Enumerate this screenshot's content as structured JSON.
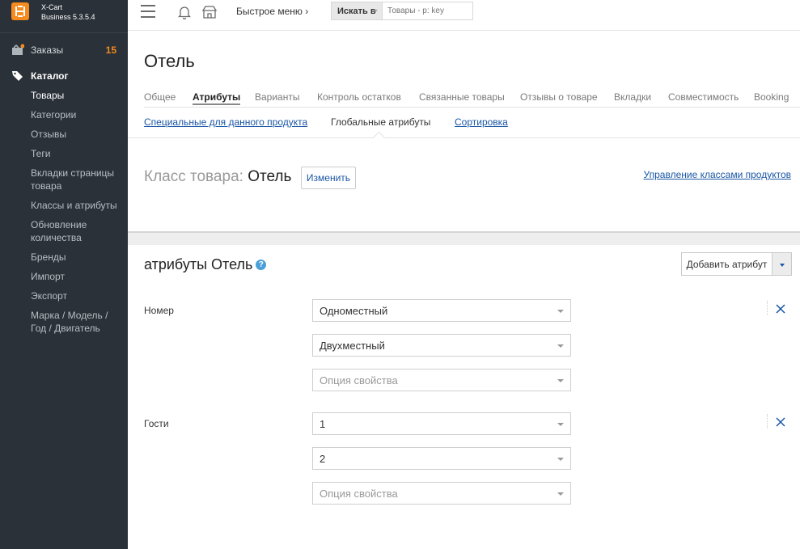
{
  "app": {
    "name_line1": "X-Cart",
    "name_line2": "Business 5.3.5.4"
  },
  "sidebar": {
    "orders": {
      "label": "Заказы",
      "badge": "15"
    },
    "catalog": {
      "label": "Каталог"
    },
    "sub_items": [
      {
        "label": "Товары"
      },
      {
        "label": "Категории"
      },
      {
        "label": "Отзывы"
      },
      {
        "label": "Теги"
      },
      {
        "label": "Вкладки страницы товара"
      },
      {
        "label": "Классы и атрибуты"
      },
      {
        "label": "Обновление количества"
      },
      {
        "label": "Бренды"
      },
      {
        "label": "Импорт"
      },
      {
        "label": "Экспорт"
      },
      {
        "label": "Марка / Модель / Год / Двигатель"
      }
    ]
  },
  "topbar": {
    "quick_menu": "Быстрое меню ›",
    "search_in": "Искать в",
    "search_placeholder": "Товары - р: key"
  },
  "page": {
    "title": "Отель",
    "tabs": [
      {
        "label": "Общее"
      },
      {
        "label": "Атрибуты"
      },
      {
        "label": "Варианты"
      },
      {
        "label": "Контроль остатков"
      },
      {
        "label": "Связанные товары"
      },
      {
        "label": "Отзывы о товаре"
      },
      {
        "label": "Вкладки"
      },
      {
        "label": "Совместимость"
      },
      {
        "label": "Booking"
      }
    ],
    "subtabs": [
      {
        "label": "Специальные для данного продукта"
      },
      {
        "label": "Глобальные атрибуты"
      },
      {
        "label": "Сортировка"
      }
    ],
    "class_prefix": "Класс товара:",
    "class_value": "Отель",
    "change_button": "Изменить",
    "manage_link": "Управление классами продуктов",
    "attributes_title": "атрибуты Отель",
    "help_glyph": "?",
    "add_button": "Добавить атрибут",
    "attributes": [
      {
        "name": "Номер",
        "values": [
          "Одноместный",
          "Двухместный"
        ],
        "placeholder": "Опция свойства"
      },
      {
        "name": "Гости",
        "values": [
          "1",
          "2"
        ],
        "placeholder": "Опция свойства"
      }
    ]
  },
  "colors": {
    "sidebar_bg": "#2a3138",
    "accent": "#f58a1f",
    "link": "#1a56a5"
  }
}
